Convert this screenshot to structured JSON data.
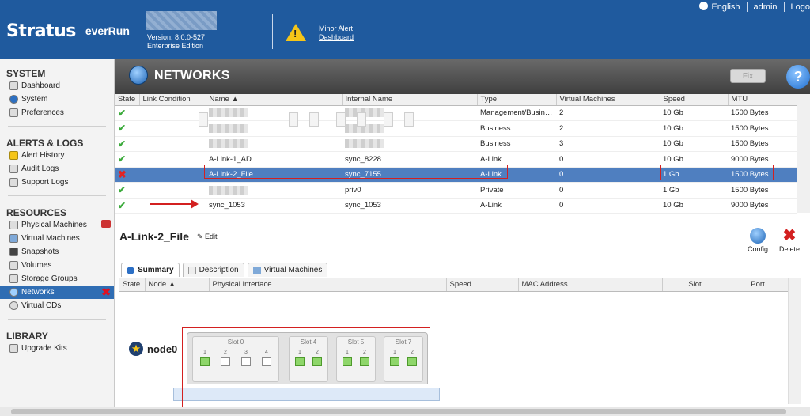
{
  "header": {
    "logo_main": "Stratus",
    "logo_sub": "everRun",
    "version": "Version: 8.0.0-527",
    "edition": "Enterprise Edition",
    "alert_title": "Minor Alert",
    "alert_link": "Dashboard",
    "language": "English",
    "user": "admin",
    "logout": "Logo"
  },
  "sidebar": {
    "system_title": "SYSTEM",
    "system_items": [
      "Dashboard",
      "System",
      "Preferences"
    ],
    "alerts_title": "ALERTS & LOGS",
    "alerts_items": [
      "Alert History",
      "Audit Logs",
      "Support Logs"
    ],
    "resources_title": "RESOURCES",
    "resources_items": [
      "Physical Machines",
      "Virtual Machines",
      "Snapshots",
      "Volumes",
      "Storage Groups",
      "Networks",
      "Virtual CDs"
    ],
    "library_title": "LIBRARY",
    "library_items": [
      "Upgrade Kits"
    ]
  },
  "page": {
    "title": "NETWORKS",
    "fix_label": "Fix",
    "help_label": "?"
  },
  "networks_table": {
    "columns": [
      "State",
      "Link Condition",
      "Name ▲",
      "Internal Name",
      "Type",
      "Virtual Machines",
      "Speed",
      "MTU"
    ],
    "rows": [
      {
        "state": "ok",
        "name": "",
        "internal": "",
        "type": "Management/Busin…",
        "vms": "2",
        "speed": "10 Gb",
        "mtu": "1500 Bytes"
      },
      {
        "state": "ok",
        "name": "",
        "internal": "",
        "type": "Business",
        "vms": "2",
        "speed": "10 Gb",
        "mtu": "1500 Bytes"
      },
      {
        "state": "ok",
        "name": "",
        "internal": "",
        "type": "Business",
        "vms": "3",
        "speed": "10 Gb",
        "mtu": "1500 Bytes"
      },
      {
        "state": "ok",
        "name": "A-Link-1_AD",
        "internal": "sync_8228",
        "type": "A-Link",
        "vms": "0",
        "speed": "10 Gb",
        "mtu": "9000 Bytes"
      },
      {
        "state": "error",
        "name": "A-Link-2_File",
        "internal": "sync_7155",
        "type": "A-Link",
        "vms": "0",
        "speed": "1 Gb",
        "mtu": "1500 Bytes"
      },
      {
        "state": "ok",
        "name": "",
        "internal": "priv0",
        "type": "Private",
        "vms": "0",
        "speed": "1 Gb",
        "mtu": "1500 Bytes"
      },
      {
        "state": "ok",
        "name": "sync_1053",
        "internal": "sync_1053",
        "type": "A-Link",
        "vms": "0",
        "speed": "10 Gb",
        "mtu": "9000 Bytes"
      }
    ]
  },
  "detail": {
    "title": "A-Link-2_File",
    "edit_label": "Edit",
    "config_label": "Config",
    "delete_label": "Delete",
    "tabs": [
      "Summary",
      "Description",
      "Virtual Machines"
    ],
    "columns": [
      "State",
      "Node ▲",
      "Physical Interface",
      "Speed",
      "MAC Address",
      "Slot",
      "Port"
    ],
    "node_name": "node0",
    "slots": [
      {
        "label": "Slot 0",
        "ports": [
          "1",
          "2",
          "3",
          "4"
        ]
      },
      {
        "label": "Slot 4",
        "ports": [
          "1",
          "2"
        ]
      },
      {
        "label": "Slot 5",
        "ports": [
          "1",
          "2"
        ]
      },
      {
        "label": "Slot 7",
        "ports": [
          "1",
          "2"
        ]
      }
    ]
  }
}
